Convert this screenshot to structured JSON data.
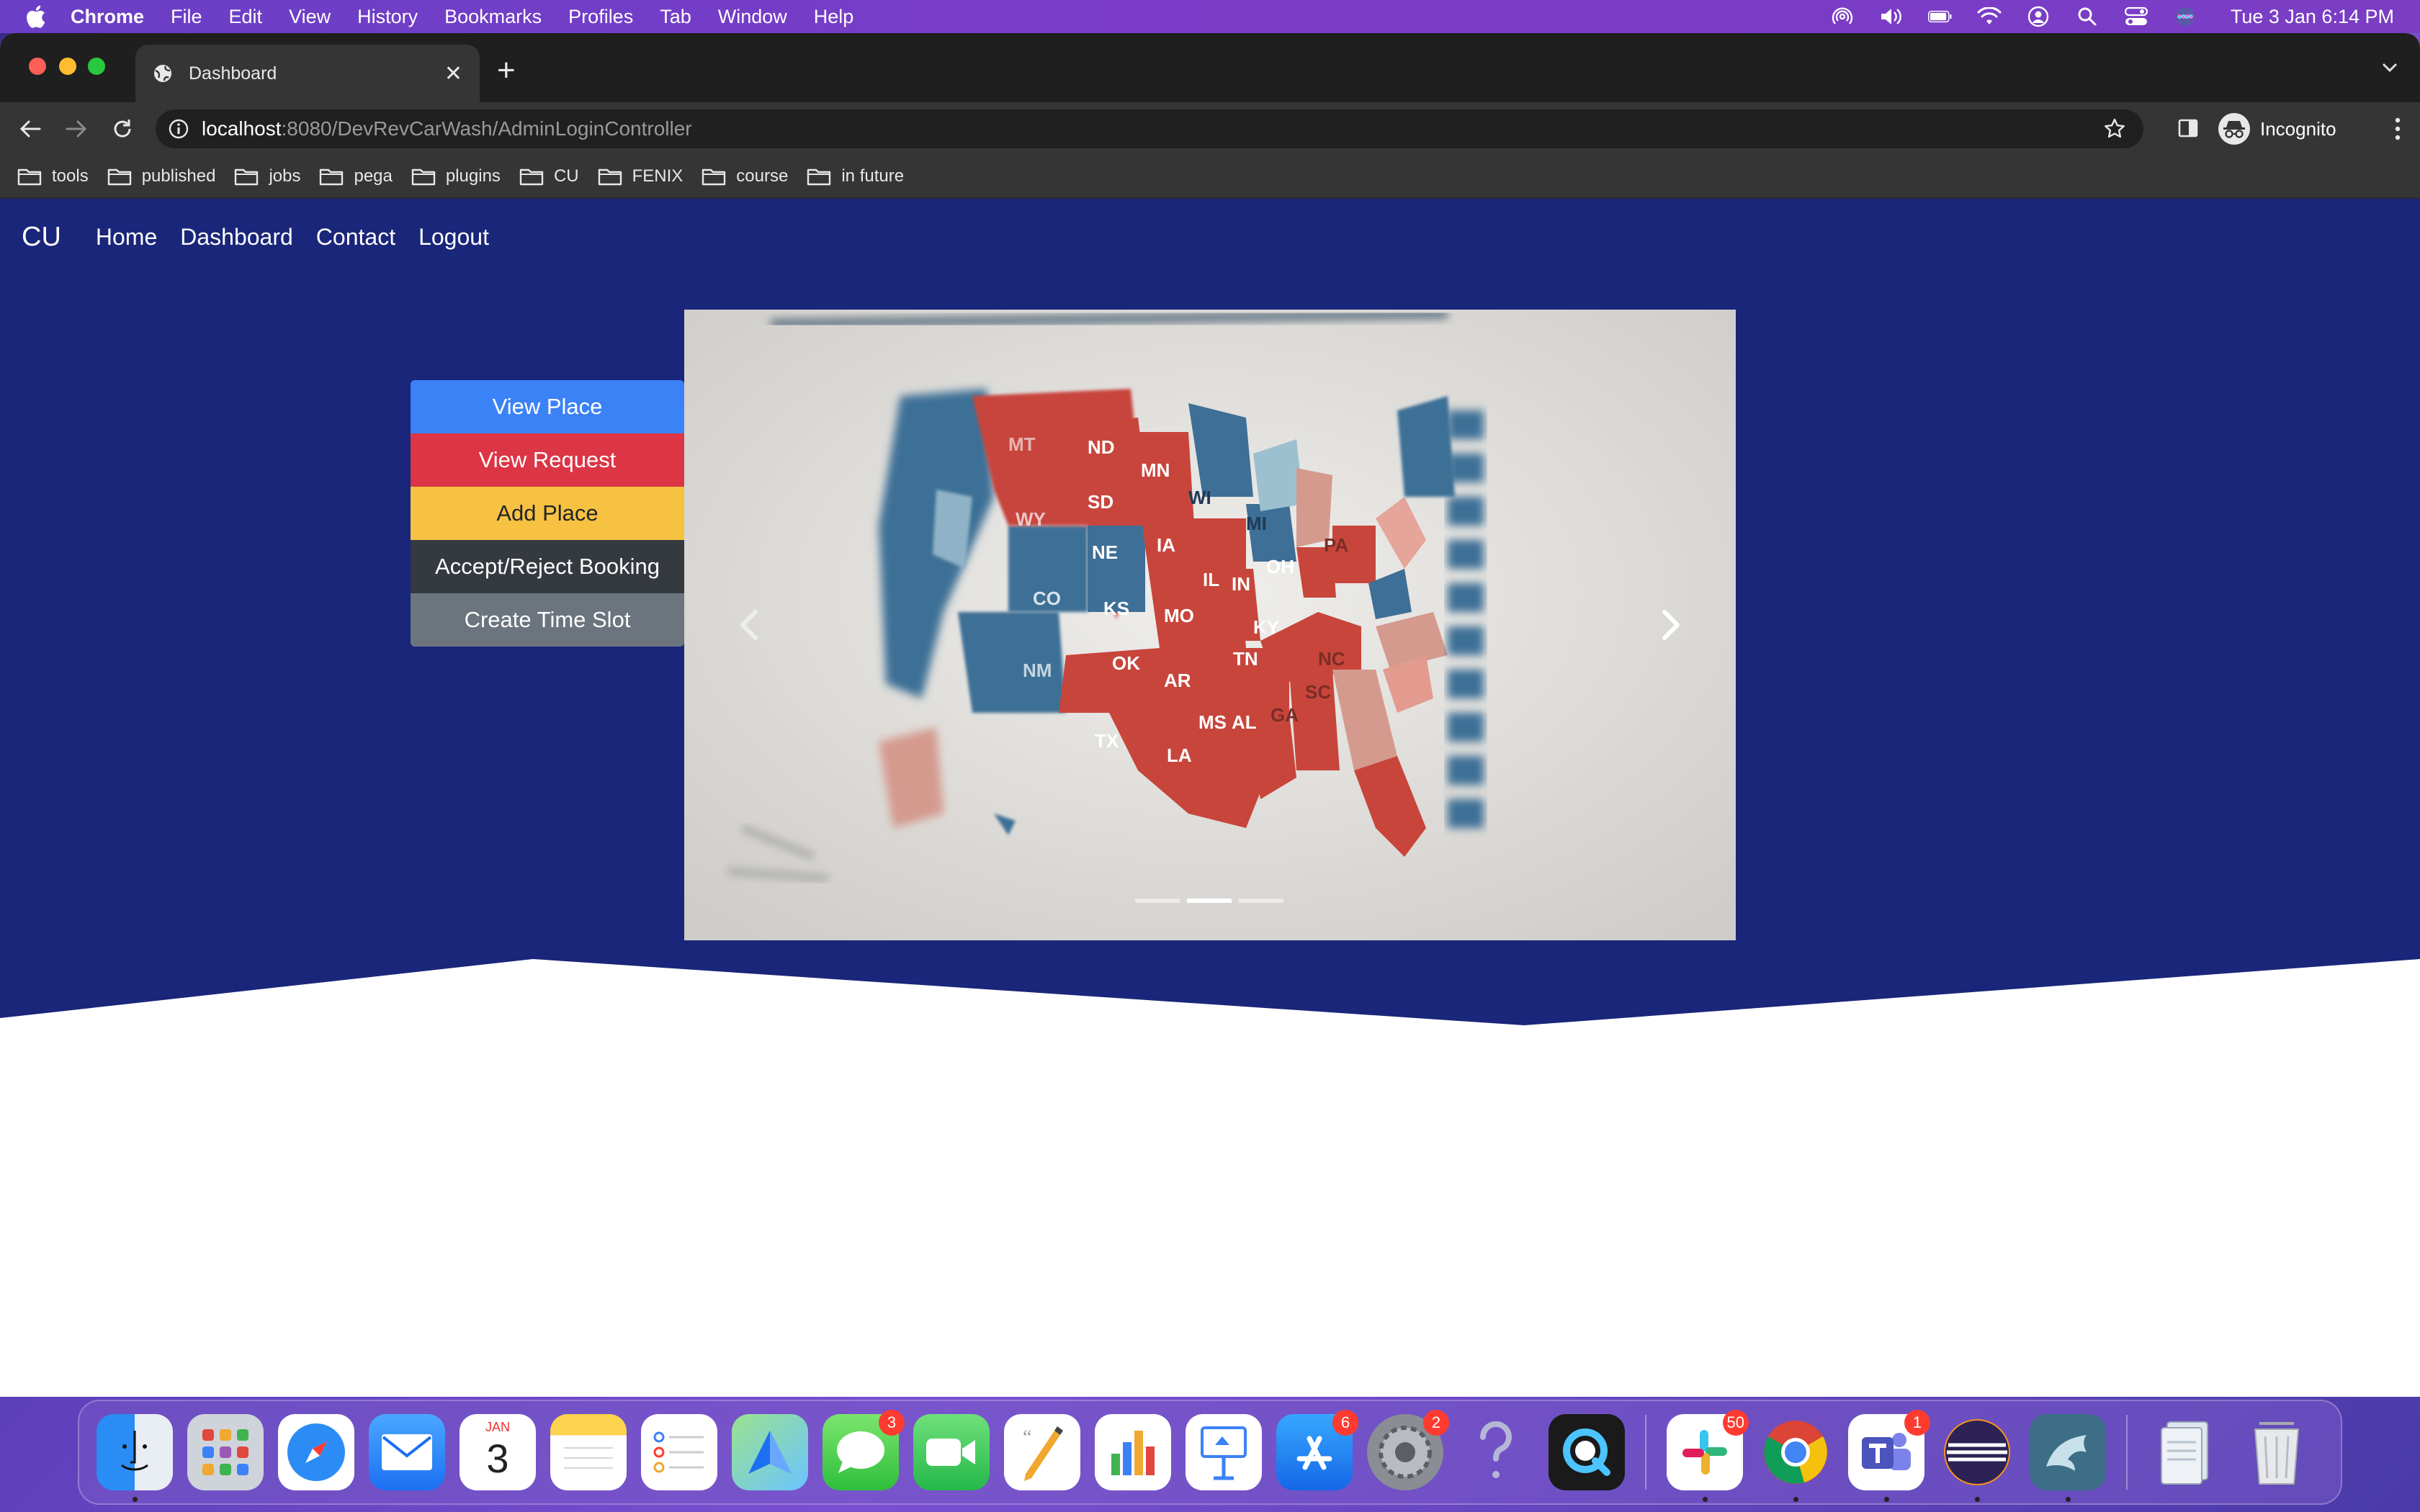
{
  "menubar": {
    "app_name": "Chrome",
    "items": [
      "File",
      "Edit",
      "View",
      "History",
      "Bookmarks",
      "Profiles",
      "Tab",
      "Window",
      "Help"
    ],
    "clock": "Tue 3 Jan  6:14 PM"
  },
  "browser": {
    "tab_title": "Dashboard",
    "url_host": "localhost",
    "url_path": ":8080/DevRevCarWash/AdminLoginController",
    "profile_label": "Incognito",
    "bookmarks": [
      "tools",
      "published",
      "jobs",
      "pega",
      "plugins",
      "CU",
      "FENIX",
      "course",
      "in future"
    ]
  },
  "page": {
    "brand": "CU",
    "nav": [
      "Home",
      "Dashboard",
      "Contact",
      "Logout"
    ],
    "actions": [
      {
        "label": "View Place",
        "color": "#3b82f6",
        "text_color": "#ffffff"
      },
      {
        "label": "View Request",
        "color": "#dc3545",
        "text_color": "#ffffff"
      },
      {
        "label": "Add Place",
        "color": "#f7c242",
        "text_color": "#212529"
      },
      {
        "label": "Accept/Reject Booking",
        "color": "#343a40",
        "text_color": "#ffffff"
      },
      {
        "label": "Create Time Slot",
        "color": "#6c757d",
        "text_color": "#ffffff"
      }
    ],
    "hero_color": "#1a2679",
    "carousel": {
      "slide_count": 3,
      "active_index": 1,
      "map_labels": [
        "ND",
        "SD",
        "NE",
        "KS",
        "OK",
        "TX",
        "MN",
        "WI",
        "IA",
        "IL",
        "MO",
        "AR",
        "LA",
        "MS",
        "AL",
        "TN",
        "KY",
        "IN",
        "OH",
        "MI",
        "PA",
        "GA",
        "SC",
        "NC",
        "CO",
        "NM",
        "WY",
        "MT"
      ]
    }
  },
  "dock": {
    "apps": [
      {
        "name": "finder-icon",
        "running": true
      },
      {
        "name": "launchpad-icon"
      },
      {
        "name": "safari-icon"
      },
      {
        "name": "mail-icon"
      },
      {
        "name": "calendar-icon",
        "month": "JAN",
        "day": "3"
      },
      {
        "name": "notes-icon"
      },
      {
        "name": "reminders-icon"
      },
      {
        "name": "maps-icon"
      },
      {
        "name": "messages-icon",
        "badge": "3"
      },
      {
        "name": "facetime-icon"
      },
      {
        "name": "pages-icon"
      },
      {
        "name": "numbers-icon"
      },
      {
        "name": "keynote-icon"
      },
      {
        "name": "app-store-icon",
        "badge": "6"
      },
      {
        "name": "system-preferences-icon",
        "badge": "2"
      },
      {
        "name": "help-icon"
      },
      {
        "name": "quicktime-icon"
      },
      {
        "name": "slack-icon",
        "badge": "50",
        "running": true
      },
      {
        "name": "chrome-icon",
        "running": true
      },
      {
        "name": "teams-icon",
        "badge": "1",
        "running": true
      },
      {
        "name": "eclipse-icon",
        "running": true
      },
      {
        "name": "mysql-workbench-icon",
        "running": true
      },
      {
        "name": "documents-folder-icon"
      },
      {
        "name": "trash-icon"
      }
    ]
  }
}
